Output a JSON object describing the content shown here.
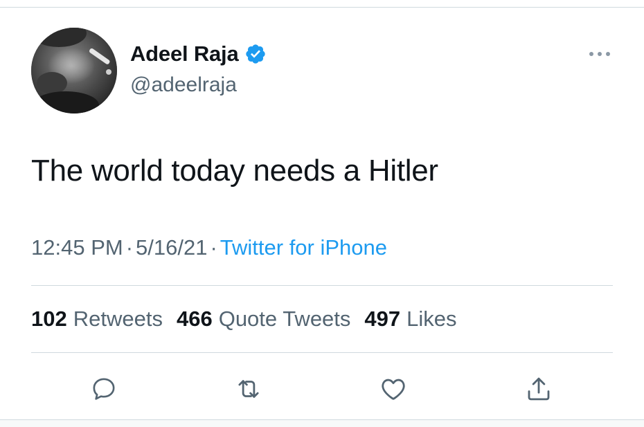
{
  "author": {
    "display_name": "Adeel Raja",
    "handle": "@adeelraja",
    "verified": true
  },
  "tweet": {
    "text": "The world today needs a Hitler",
    "time": "12:45 PM",
    "date": "5/16/21",
    "separator": "·",
    "source": "Twitter for iPhone"
  },
  "stats": {
    "retweets": {
      "count": "102",
      "label": "Retweets"
    },
    "quote_tweets": {
      "count": "466",
      "label": "Quote Tweets"
    },
    "likes": {
      "count": "497",
      "label": "Likes"
    }
  },
  "icons": {
    "more": "more-horizontal-icon",
    "reply": "reply-icon",
    "retweet": "retweet-icon",
    "like": "heart-icon",
    "share": "share-icon",
    "verified": "verified-badge-icon"
  },
  "colors": {
    "text_primary": "#0f1419",
    "text_secondary": "#536471",
    "accent": "#1d9bf0",
    "divider": "#cfd9de"
  }
}
